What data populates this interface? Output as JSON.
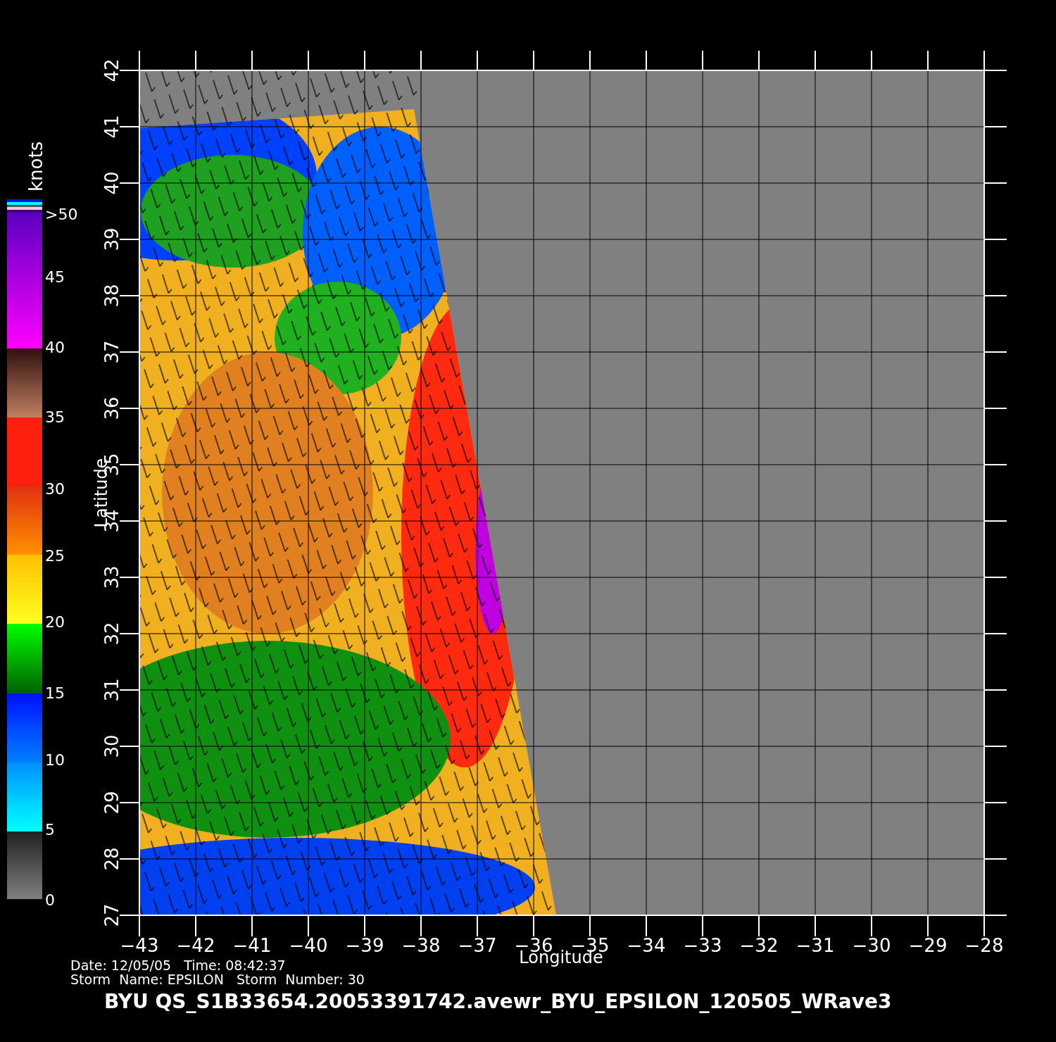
{
  "plot": {
    "x_axis": {
      "label": "Longitude",
      "ticks": [
        "−43",
        "−42",
        "−41",
        "−40",
        "−39",
        "−38",
        "−37",
        "−36",
        "−35",
        "−34",
        "−33",
        "−32",
        "−31",
        "−30",
        "−29",
        "−28"
      ]
    },
    "y_axis": {
      "label": "Latitude",
      "ticks": [
        "27",
        "28",
        "29",
        "30",
        "31",
        "32",
        "33",
        "34",
        "35",
        "36",
        "37",
        "38",
        "39",
        "40",
        "41",
        "42"
      ]
    }
  },
  "legend": {
    "unit": "knots",
    "labels": [
      ">50",
      "45",
      "40",
      "35",
      "30",
      "25",
      "20",
      "15",
      "10",
      "5",
      "0"
    ]
  },
  "info": [
    "Date: 12/05/05   Time: 08:42:37",
    "Storm  Name: EPSILON   Storm  Number: 30"
  ],
  "title": "BYU  QS_S1B33654.20053391742.avewr_BYU_EPSILON_120505_WRave3"
}
